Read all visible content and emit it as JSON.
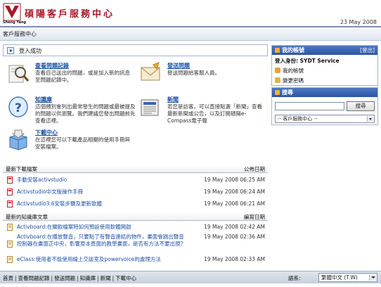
{
  "header": {
    "logo_text": "Sheng Yang",
    "title": "碩陽客戶服務中心",
    "date": "23 May 2008"
  },
  "breadcrumb": "客戶服務中心",
  "notice": "登入成功",
  "features": [
    {
      "title": "查看問題記錄",
      "desc": "查看自己送出的問題，或是加入新的訊息至問題記錄中。",
      "icon": "magnifier-icon"
    },
    {
      "title": "發送問題",
      "desc": "發送問題給客服人員。",
      "icon": "envelope-icon"
    },
    {
      "title": "知識庫",
      "desc": "這個頻別會列出最常發生的問題或最被提及的問題以供瀏覽。我們建議您發出問題前先查看這裡。",
      "icon": "question-head-icon"
    },
    {
      "title": "新聞",
      "desc": "若您是訪客，可以直接點選「新聞」查看最新新聞或公告，以及訂閱碩陽e-Compass電子報",
      "icon": "newspaper-icon"
    },
    {
      "title": "下載中心",
      "desc": "在這裡您可以下載產品相關的使用手冊與安裝檔案。",
      "icon": "download-box-icon"
    }
  ],
  "downloads": {
    "header_left": "最新下載檔案",
    "header_right": "公佈日期",
    "items": [
      {
        "label": "手動安裝activstudio",
        "date": "19 May 2008 06:25 AM"
      },
      {
        "label": "Activstudio中文版操作手冊",
        "date": "19 May 2008 06:24 AM"
      },
      {
        "label": "Activstudio3.6安裝步驟及更新軟體",
        "date": "19 May 2008 06:21 AM"
      }
    ]
  },
  "knowledge": {
    "header_left": "最新的知識庫文章",
    "header_right": "編寫日期",
    "items": [
      {
        "label": "Activboard:在關飲檔案時如何預設使用軟體開啟",
        "date": "19 May 2008 02:42 AM"
      },
      {
        "label": "Activboard:在播放聲音，只要點了有聲音連結的物件，畫面會跳出聲音控制器在畫面正中央，影響原本頁面的教學畫面，是否有方法不要出現？",
        "date": "19 May 2008 02:36 AM"
      },
      {
        "label": "eClass:使用者不能使用線上交談室及powervoice的處理方法",
        "date": "19 May 2008 02:33 AM"
      }
    ]
  },
  "account_panel": {
    "title": "我的帳號",
    "logout": "[登出]",
    "login_as": "登入身份: SYDT Service",
    "items": [
      "我的帳號",
      "變更密碼"
    ]
  },
  "search_panel": {
    "title": "搜尋",
    "input_value": "",
    "button": "搜尋",
    "select_value": "-- 客戶服務中心 --"
  },
  "footer": {
    "links": [
      "首頁",
      "查看問題記錄",
      "發送問題",
      "知識庫",
      "新聞",
      "下載中心"
    ],
    "lang_label": "語系:",
    "lang_value": "繁體中文 (T.W)"
  },
  "colors": {
    "brand": "#a71828",
    "link": "#1c4fa5",
    "panel_header": "#2c55a3"
  }
}
